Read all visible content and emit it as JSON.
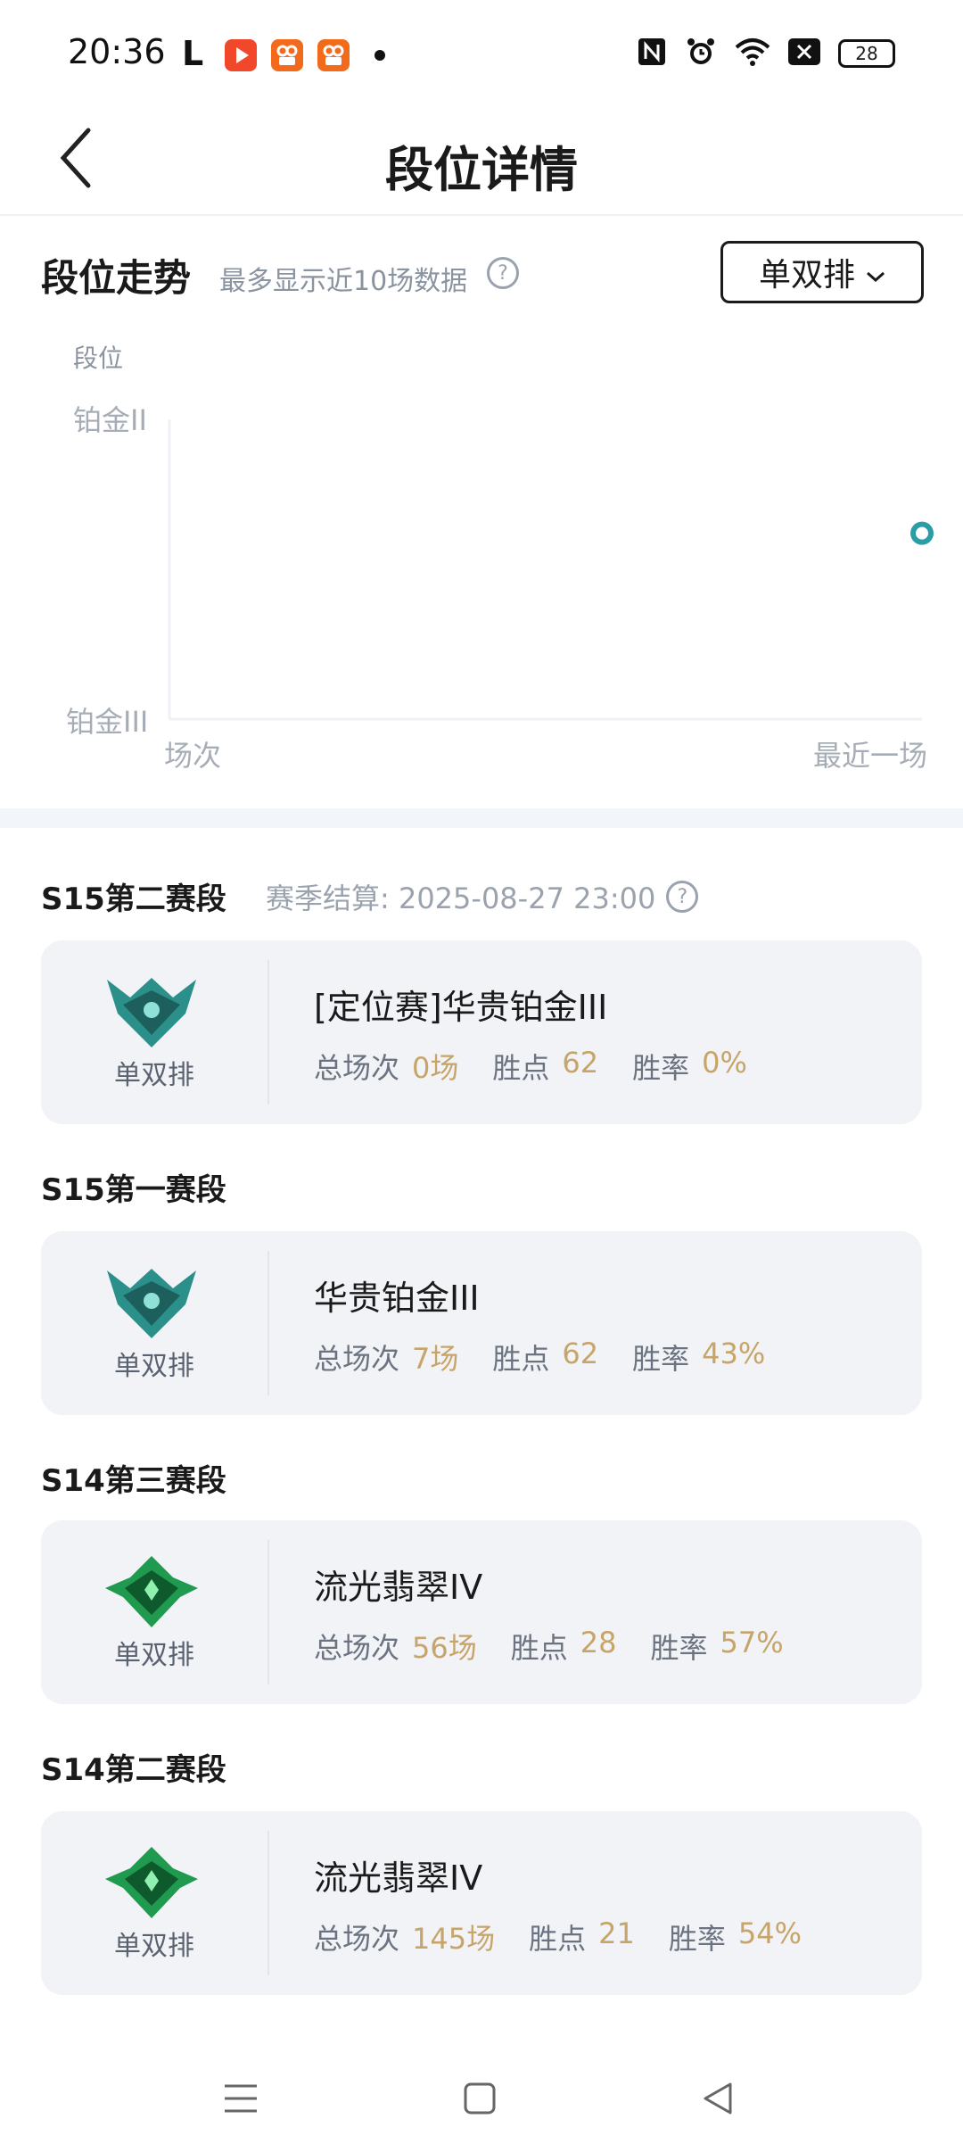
{
  "status_bar": {
    "time": "20:36",
    "app_letter": "L",
    "battery": "28",
    "icons": [
      "nfc-icon",
      "alarm-icon",
      "wifi-icon",
      "sim-off-icon",
      "battery-icon"
    ]
  },
  "header": {
    "title": "段位详情",
    "back_icon": "chevron-left-icon"
  },
  "trend": {
    "title": "段位走势",
    "subtitle": "最多显示近10场数据",
    "help_icon": "question-circle-icon",
    "queue_selector": "单双排",
    "dropdown_icon": "chevron-down-icon"
  },
  "chart_data": {
    "type": "scatter",
    "ylabel": "段位",
    "y_ticks": [
      "铂金II",
      "铂金III"
    ],
    "x_start_label": "场次",
    "x_end_label": "最近一场",
    "points": [
      {
        "x": "最近一场",
        "y_fraction": 0.62
      }
    ],
    "point_color": "#2a9da6"
  },
  "seasons": [
    {
      "title": "S15第二赛段",
      "note": "赛季结算: 2025-08-27 23:00",
      "queue": "单双排",
      "rank": "[定位赛]华贵铂金III",
      "stats": [
        {
          "label": "总场次",
          "value": "0场"
        },
        {
          "label": "胜点",
          "value": "62"
        },
        {
          "label": "胜率",
          "value": "0%"
        }
      ],
      "emblem": "platinum-emblem-icon"
    },
    {
      "title": "S15第一赛段",
      "queue": "单双排",
      "rank": "华贵铂金III",
      "stats": [
        {
          "label": "总场次",
          "value": "7场"
        },
        {
          "label": "胜点",
          "value": "62"
        },
        {
          "label": "胜率",
          "value": "43%"
        }
      ],
      "emblem": "platinum-emblem-icon"
    },
    {
      "title": "S14第三赛段",
      "queue": "单双排",
      "rank": "流光翡翠IV",
      "stats": [
        {
          "label": "总场次",
          "value": "56场"
        },
        {
          "label": "胜点",
          "value": "28"
        },
        {
          "label": "胜率",
          "value": "57%"
        }
      ],
      "emblem": "emerald-emblem-icon"
    },
    {
      "title": "S14第二赛段",
      "queue": "单双排",
      "rank": "流光翡翠IV",
      "stats": [
        {
          "label": "总场次",
          "value": "145场"
        },
        {
          "label": "胜点",
          "value": "21"
        },
        {
          "label": "胜率",
          "value": "54%"
        }
      ],
      "emblem": "emerald-emblem-icon"
    }
  ],
  "colors": {
    "accent_value": "#c7a46a",
    "card_bg": "#f1f3f7",
    "platinum": "#2b8f8a",
    "emerald": "#1f9a4e"
  },
  "navbar": {
    "icons": [
      "menu-icon",
      "home-square-icon",
      "back-triangle-icon"
    ]
  }
}
